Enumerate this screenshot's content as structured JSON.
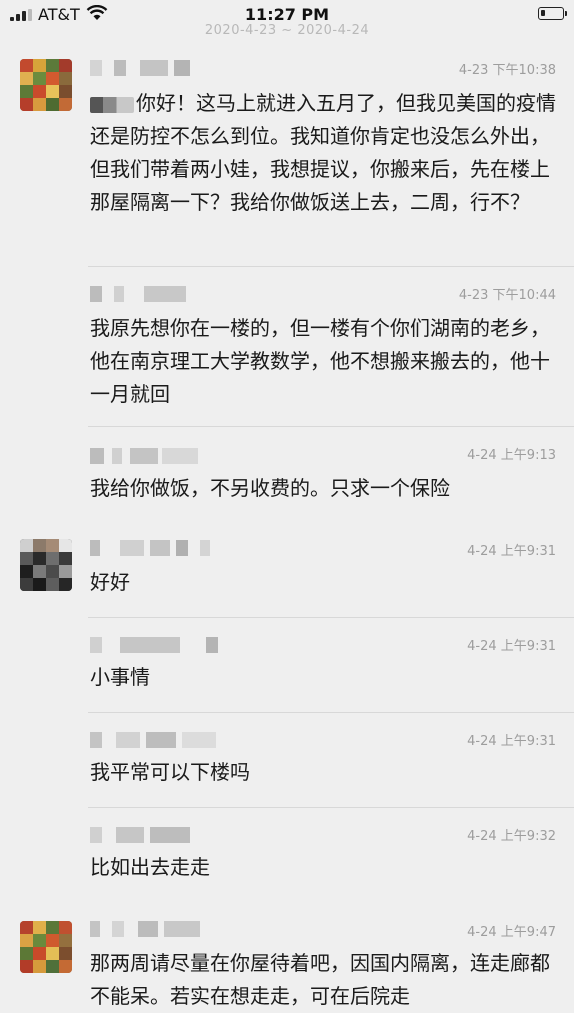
{
  "status_bar": {
    "carrier": "AT&T",
    "time": "11:27 PM",
    "signal_icon": "signal-bars-icon",
    "wifi_icon": "wifi-icon",
    "battery_icon": "battery-icon",
    "battery_level": 0.2
  },
  "date_range": "2020-4-23 ~ 2020-4-24",
  "messages": [
    {
      "time": "4-23 下午10:38",
      "text": "你好！这马上就进入五月了，但我见美国的疫情还是防控不怎么到位。我知道你肯定也没怎么外出，但我们带着两小娃，我想提议，你搬来后，先在楼上那屋隔离一下？我给你做饭送上去，二周，行不？",
      "has_redacted_prefix": true
    },
    {
      "time": "4-23 下午10:44",
      "text": "我原先想你在一楼的，但一楼有个你们湖南的老乡，他在南京理工大学教数学，他不想搬来搬去的，他十一月就回"
    },
    {
      "time": "4-24 上午9:13",
      "text": "我给你做饭，不另收费的。只求一个保险"
    },
    {
      "time": "4-24 上午9:31",
      "text": "好好"
    },
    {
      "time": "4-24 上午9:31",
      "text": "小事情"
    },
    {
      "time": "4-24 上午9:31",
      "text": "我平常可以下楼吗"
    },
    {
      "time": "4-24 上午9:32",
      "text": "比如出去走走"
    },
    {
      "time": "4-24 上午9:47",
      "text": "那两周请尽量在你屋待着吧，因国内隔离，连走廊都不能呆。若实在想走走，可在后院走"
    }
  ]
}
